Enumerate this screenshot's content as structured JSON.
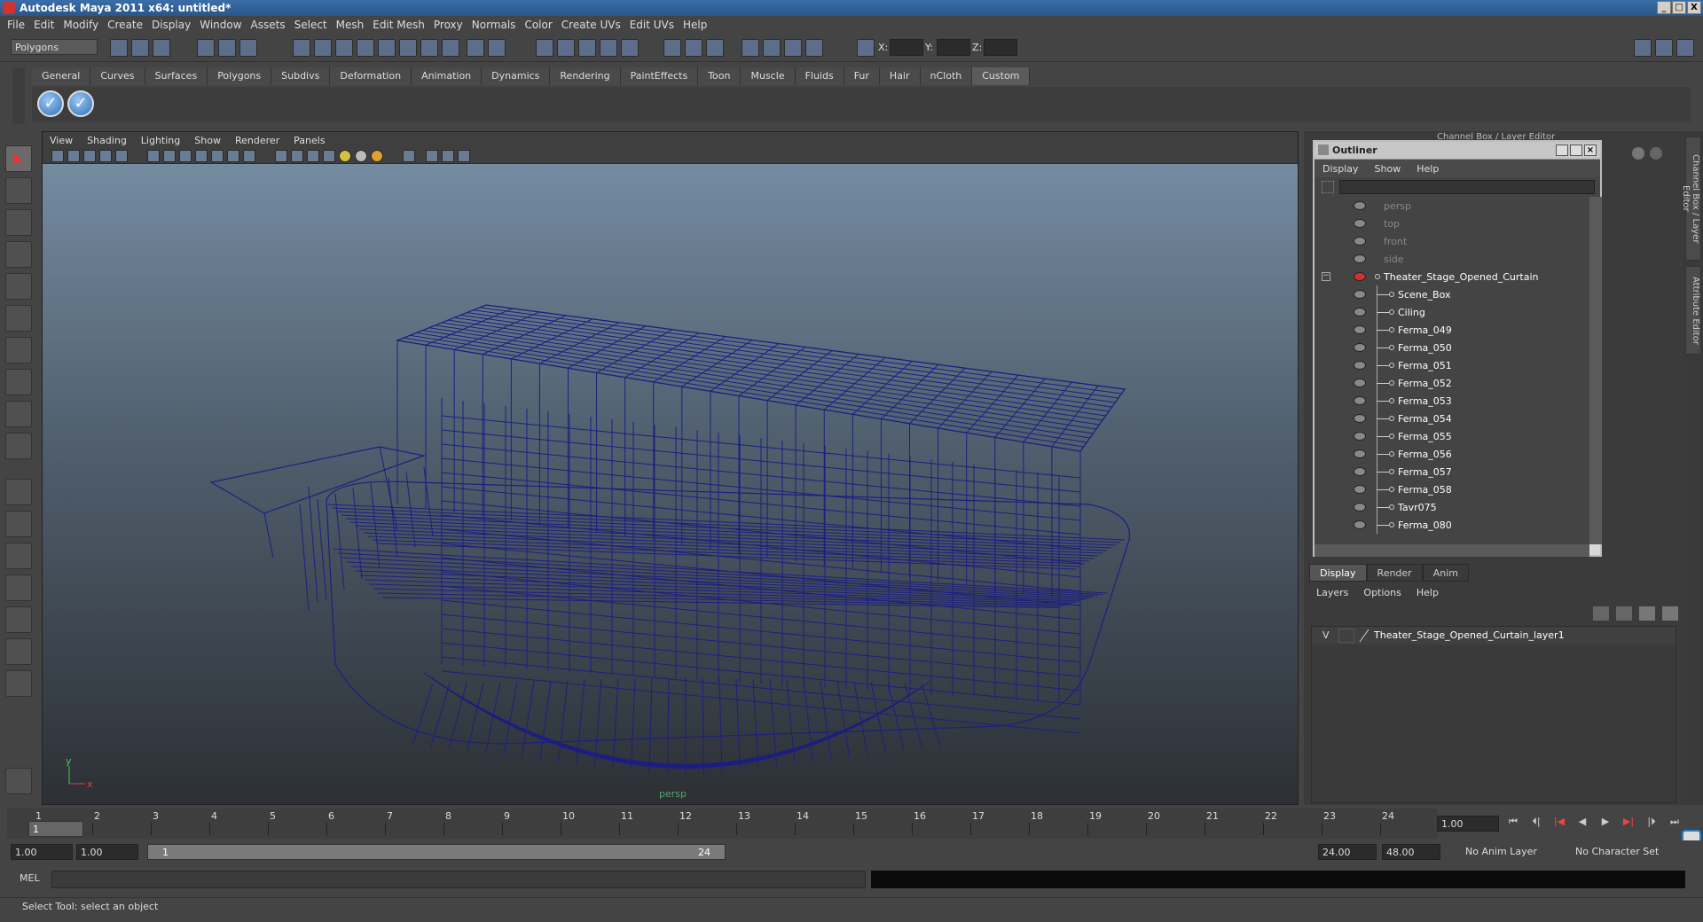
{
  "window": {
    "title": "Autodesk Maya 2011 x64: untitled*",
    "minimize": "_",
    "maximize": "□",
    "close": "X"
  },
  "menubar": [
    "File",
    "Edit",
    "Modify",
    "Create",
    "Display",
    "Window",
    "Assets",
    "Select",
    "Mesh",
    "Edit Mesh",
    "Proxy",
    "Normals",
    "Color",
    "Create UVs",
    "Edit UVs",
    "Help"
  ],
  "statusline": {
    "mode": "Polygons",
    "x_label": "X:",
    "y_label": "Y:",
    "z_label": "Z:"
  },
  "shelf": {
    "tabs": [
      "General",
      "Curves",
      "Surfaces",
      "Polygons",
      "Subdivs",
      "Deformation",
      "Animation",
      "Dynamics",
      "Rendering",
      "PaintEffects",
      "Toon",
      "Muscle",
      "Fluids",
      "Fur",
      "Hair",
      "nCloth",
      "Custom"
    ],
    "active_tab": "Custom"
  },
  "viewport": {
    "menu": [
      "View",
      "Shading",
      "Lighting",
      "Show",
      "Renderer",
      "Panels"
    ],
    "camera": "persp",
    "axis_y": "y",
    "axis_x": "x",
    "wire_color": "#1c1f80"
  },
  "channelbox": {
    "title": "Channel Box / Layer Editor"
  },
  "side_tabs": {
    "channel": "Channel Box / Layer Editor",
    "attribute": "Attribute Editor"
  },
  "outliner": {
    "title": "Outliner",
    "menu": [
      "Display",
      "Show",
      "Help"
    ],
    "items": [
      {
        "label": "persp",
        "dim": true,
        "level": 0
      },
      {
        "label": "top",
        "dim": true,
        "level": 0
      },
      {
        "label": "front",
        "dim": true,
        "level": 0
      },
      {
        "label": "side",
        "dim": true,
        "level": 0
      },
      {
        "label": "Theater_Stage_Opened_Curtain",
        "dim": false,
        "level": 0,
        "expanded": true
      },
      {
        "label": "Scene_Box",
        "dim": false,
        "level": 1
      },
      {
        "label": "Ciling",
        "dim": false,
        "level": 1
      },
      {
        "label": "Ferma_049",
        "dim": false,
        "level": 1
      },
      {
        "label": "Ferma_050",
        "dim": false,
        "level": 1
      },
      {
        "label": "Ferma_051",
        "dim": false,
        "level": 1
      },
      {
        "label": "Ferma_052",
        "dim": false,
        "level": 1
      },
      {
        "label": "Ferma_053",
        "dim": false,
        "level": 1
      },
      {
        "label": "Ferma_054",
        "dim": false,
        "level": 1
      },
      {
        "label": "Ferma_055",
        "dim": false,
        "level": 1
      },
      {
        "label": "Ferma_056",
        "dim": false,
        "level": 1
      },
      {
        "label": "Ferma_057",
        "dim": false,
        "level": 1
      },
      {
        "label": "Ferma_058",
        "dim": false,
        "level": 1
      },
      {
        "label": "Tavr075",
        "dim": false,
        "level": 1
      },
      {
        "label": "Ferma_080",
        "dim": false,
        "level": 1
      }
    ]
  },
  "layers": {
    "tabs": [
      "Display",
      "Render",
      "Anim"
    ],
    "active_tab": "Display",
    "menu": [
      "Layers",
      "Options",
      "Help"
    ],
    "rows": [
      {
        "visible": "V",
        "name": "Theater_Stage_Opened_Curtain_layer1"
      }
    ]
  },
  "timeslider": {
    "ticks": [
      "1",
      "2",
      "3",
      "4",
      "5",
      "6",
      "7",
      "8",
      "9",
      "10",
      "11",
      "12",
      "13",
      "14",
      "15",
      "16",
      "17",
      "18",
      "19",
      "20",
      "21",
      "22",
      "23",
      "24"
    ],
    "current_marker": "1",
    "current_frame": "1.00"
  },
  "playback": {
    "buttons": [
      "⏮",
      "⏴|",
      "|◀",
      "◀",
      "▶",
      "▶|",
      "|⏵",
      "⏭"
    ]
  },
  "range": {
    "start": "1.00",
    "playback_start": "1.00",
    "slider_start": "1",
    "slider_end": "24",
    "playback_end": "24.00",
    "end": "48.00",
    "anim_layer": "No Anim Layer",
    "character_set": "No Character Set"
  },
  "commandline": {
    "mode": "MEL"
  },
  "helpline": {
    "text": "Select Tool: select an object"
  }
}
